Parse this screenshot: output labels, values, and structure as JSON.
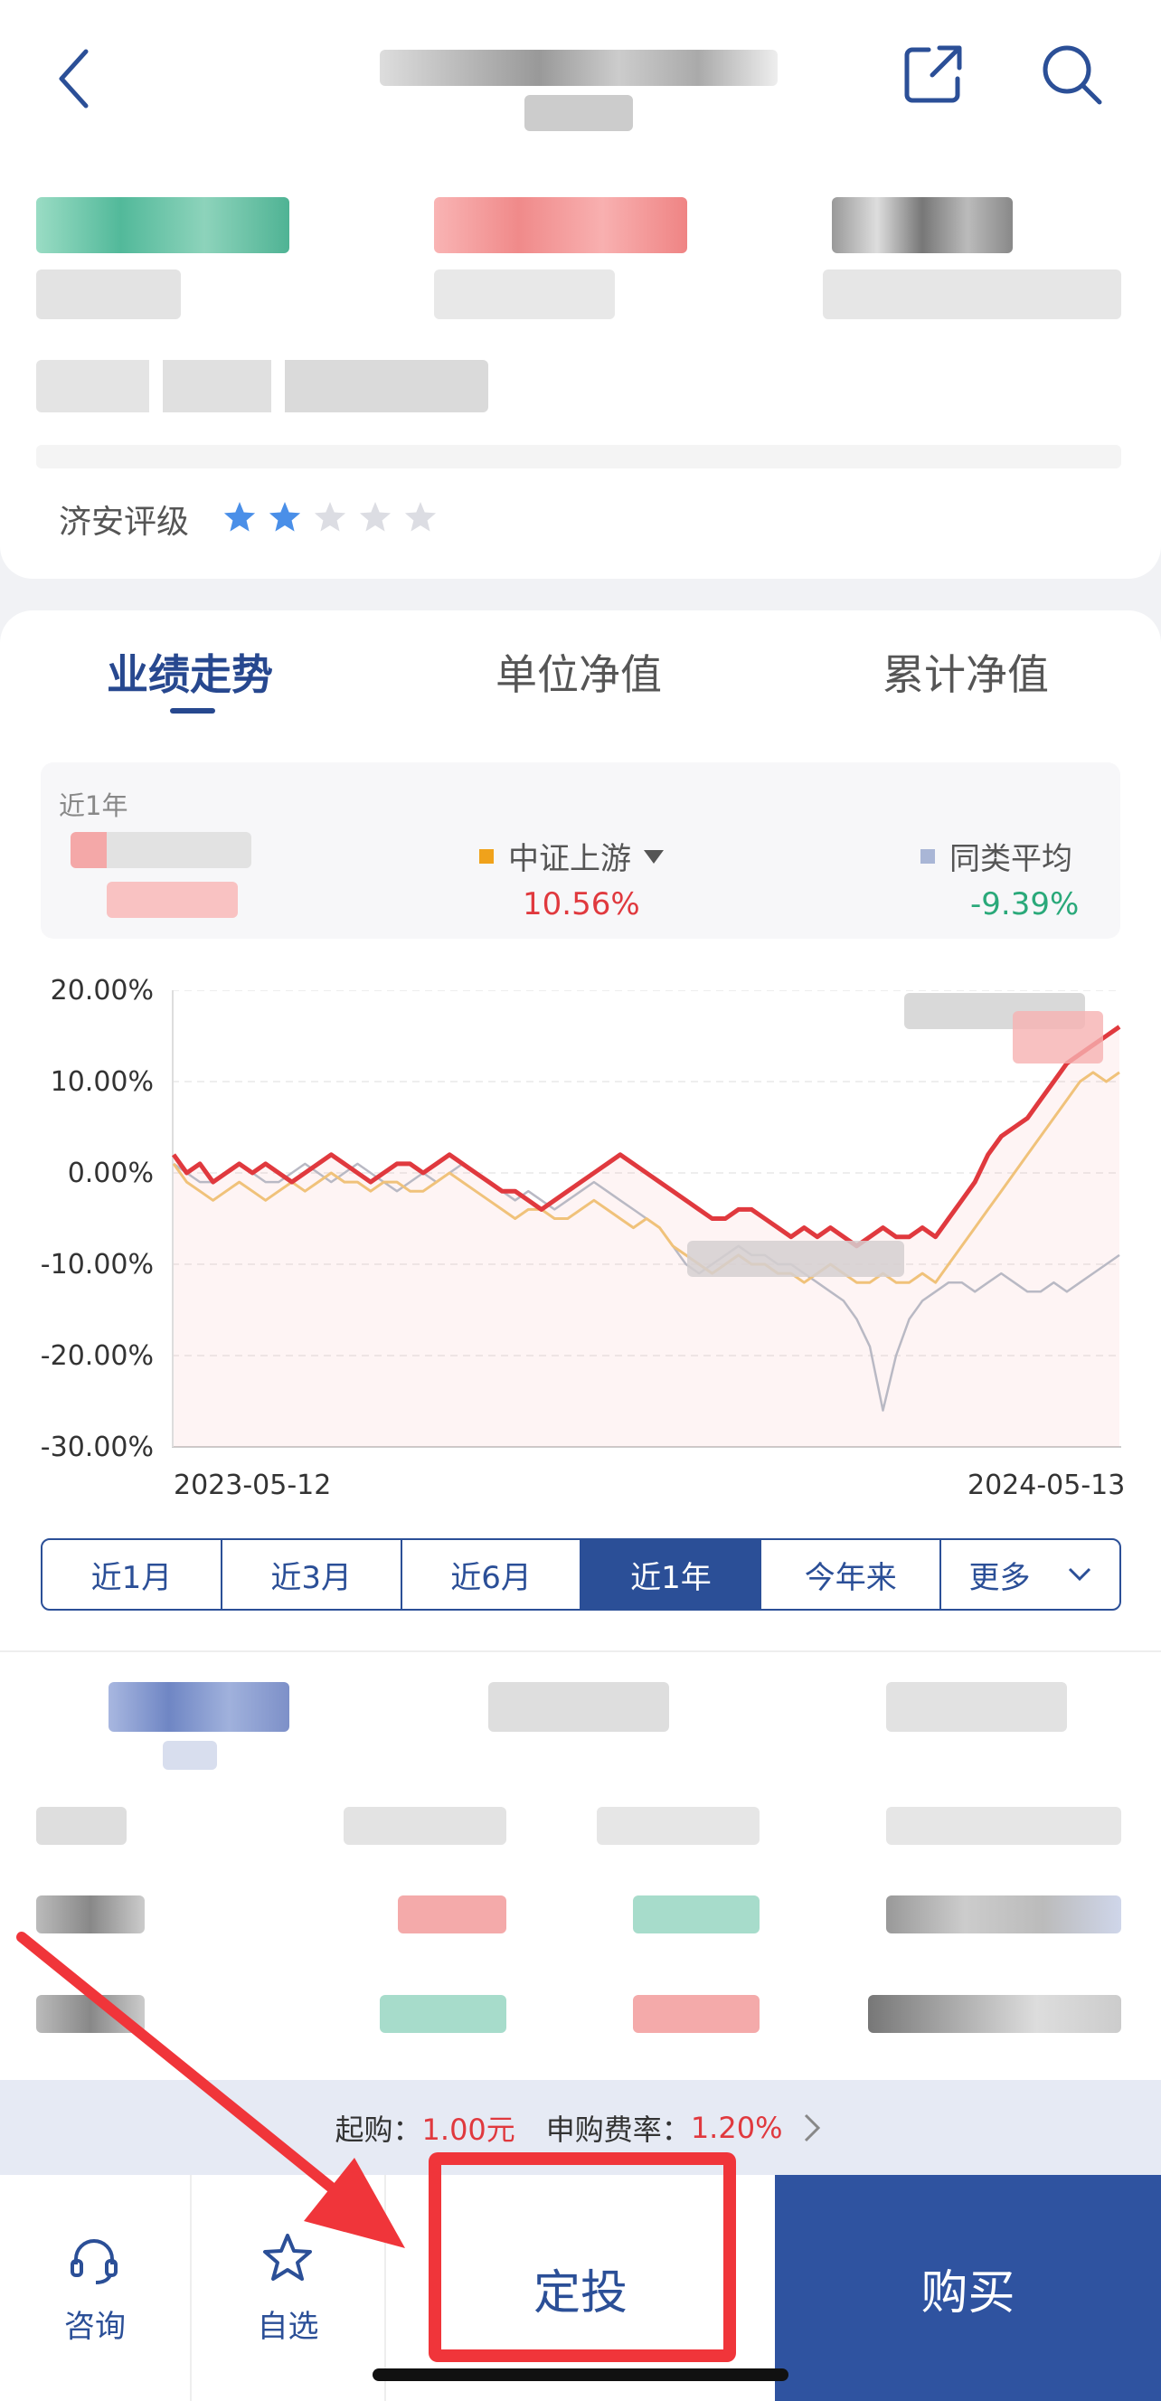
{
  "header": {
    "back_icon": "chevron-left-icon",
    "share_icon": "share-icon",
    "search_icon": "search-icon"
  },
  "rating": {
    "label": "济安评级",
    "stars_filled": 2,
    "stars_total": 5
  },
  "tabs": [
    {
      "label": "业绩走势",
      "active": true
    },
    {
      "label": "单位净值",
      "active": false
    },
    {
      "label": "累计净值",
      "active": false
    }
  ],
  "summary": {
    "period_label": "近1年",
    "benchmark": {
      "label": "中证上游",
      "value": "10.56%",
      "color": "#e0393e",
      "marker_color": "#f0a21b"
    },
    "peer": {
      "label": "同类平均",
      "value": "-9.39%",
      "color": "#2aa97a",
      "marker_color": "#a9b6d6"
    }
  },
  "chart_data": {
    "type": "line",
    "x_start": "2023-05-12",
    "x_end": "2024-05-13",
    "ylim": [
      -30,
      20
    ],
    "yticks": [
      "20.00%",
      "10.00%",
      "0.00%",
      "-10.00%",
      "-20.00%",
      "-30.00%"
    ],
    "grid": true,
    "series": [
      {
        "color": "#e0393e",
        "values": [
          2,
          0,
          1,
          -1,
          0,
          1,
          0,
          1,
          0,
          -1,
          0,
          1,
          2,
          1,
          0,
          -1,
          0,
          1,
          1,
          0,
          1,
          2,
          1,
          0,
          -1,
          -2,
          -2,
          -3,
          -4,
          -3,
          -2,
          -1,
          0,
          1,
          2,
          1,
          0,
          -1,
          -2,
          -3,
          -4,
          -5,
          -5,
          -4,
          -4,
          -5,
          -6,
          -7,
          -6,
          -7,
          -6,
          -7,
          -8,
          -7,
          -6,
          -7,
          -7,
          -6,
          -7,
          -5,
          -3,
          -1,
          2,
          4,
          5,
          6,
          8,
          10,
          12,
          13,
          14,
          15,
          16
        ]
      },
      {
        "name": "中证上游",
        "color": "#f0c27a",
        "values": [
          1,
          -1,
          -2,
          -3,
          -2,
          -1,
          -2,
          -3,
          -2,
          -1,
          -2,
          -1,
          0,
          -1,
          -1,
          -2,
          -1,
          -1,
          -2,
          -2,
          -1,
          0,
          -1,
          -2,
          -3,
          -4,
          -5,
          -4,
          -4,
          -5,
          -5,
          -4,
          -3,
          -4,
          -5,
          -6,
          -5,
          -6,
          -8,
          -9,
          -10,
          -11,
          -10,
          -9,
          -10,
          -10,
          -11,
          -11,
          -12,
          -11,
          -10,
          -11,
          -12,
          -12,
          -11,
          -12,
          -12,
          -11,
          -12,
          -10,
          -8,
          -6,
          -4,
          -2,
          0,
          2,
          4,
          6,
          8,
          10,
          11,
          10,
          11
        ]
      },
      {
        "name": "同类平均",
        "color": "#b9b9c4",
        "values": [
          1,
          0,
          -1,
          -1,
          0,
          1,
          0,
          -1,
          -1,
          0,
          1,
          0,
          -1,
          0,
          1,
          0,
          -1,
          -2,
          -1,
          0,
          -1,
          0,
          1,
          0,
          -1,
          -2,
          -3,
          -2,
          -3,
          -4,
          -3,
          -2,
          -1,
          -2,
          -3,
          -4,
          -5,
          -6,
          -8,
          -10,
          -11,
          -10,
          -9,
          -8,
          -9,
          -9,
          -10,
          -10,
          -11,
          -12,
          -13,
          -14,
          -16,
          -19,
          -26,
          -20,
          -16,
          -14,
          -13,
          -12,
          -12,
          -13,
          -12,
          -11,
          -12,
          -13,
          -13,
          -12,
          -13,
          -12,
          -11,
          -10,
          -9
        ]
      }
    ]
  },
  "periods": [
    "近1月",
    "近3月",
    "近6月",
    "近1年",
    "今年来",
    "更多"
  ],
  "active_period": "近1年",
  "fees": {
    "min_label": "起购：",
    "min_value": "1.00元",
    "rate_label": "申购费率：",
    "rate_value": "1.20%"
  },
  "bottom_bar": {
    "consult": "咨询",
    "watch": "自选",
    "plan": "定投",
    "buy": "购买",
    "consult_icon": "headset-icon",
    "watch_icon": "star-icon"
  },
  "colors": {
    "primary": "#2b4f97",
    "red": "#e0393e",
    "green": "#2aa97a",
    "annotation": "#f0353a"
  }
}
